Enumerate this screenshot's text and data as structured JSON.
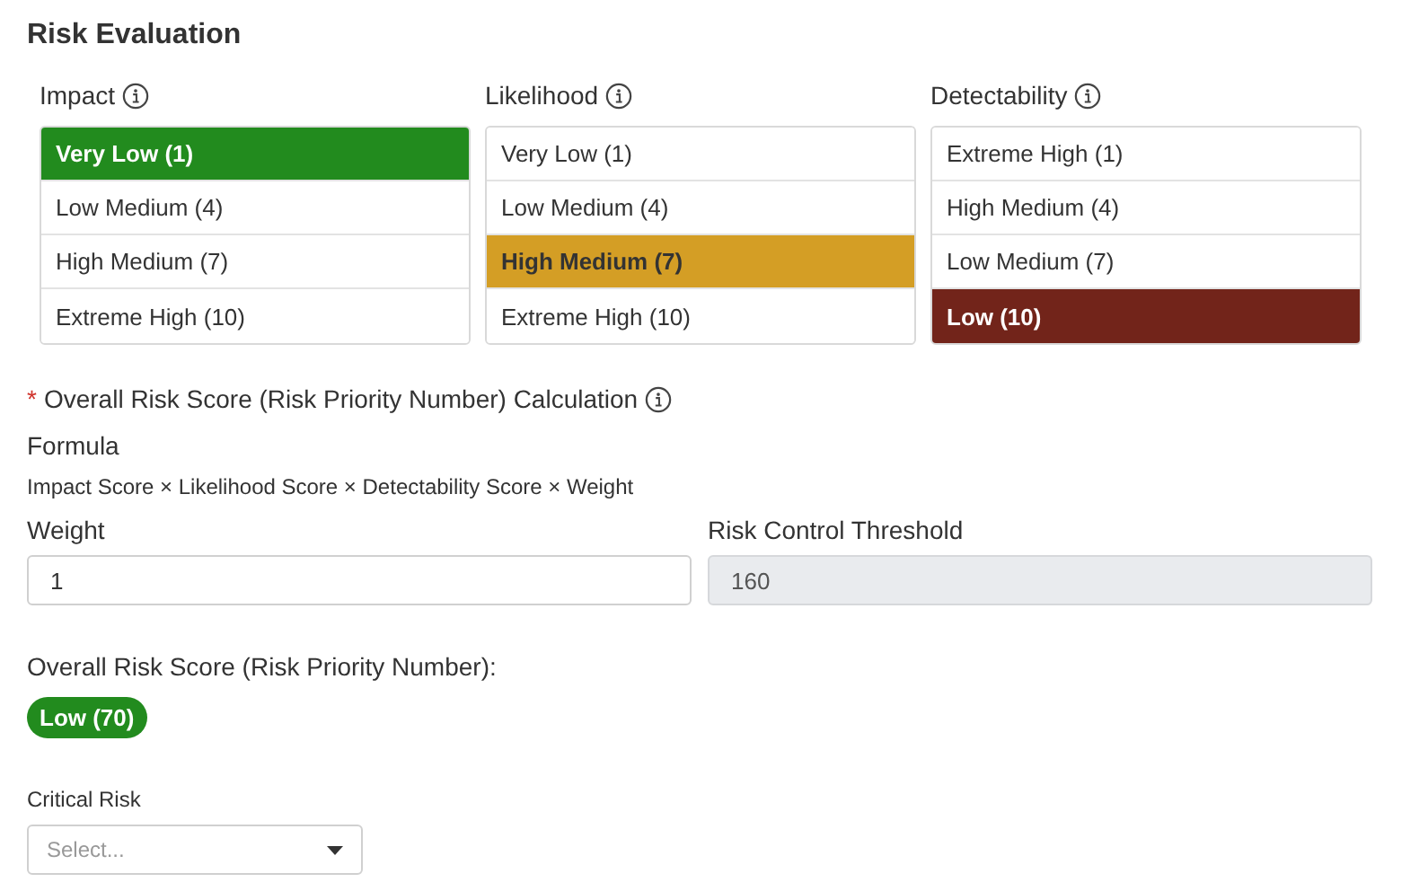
{
  "title": "Risk Evaluation",
  "groups": [
    {
      "label": "Impact",
      "color": "#228b1e",
      "options": [
        {
          "label": "Very Low (1)",
          "selected": true
        },
        {
          "label": "Low Medium (4)",
          "selected": false
        },
        {
          "label": "High Medium (7)",
          "selected": false
        },
        {
          "label": "Extreme High (10)",
          "selected": false
        }
      ]
    },
    {
      "label": "Likelihood",
      "color": "#d49e25",
      "options": [
        {
          "label": "Very Low (1)",
          "selected": false
        },
        {
          "label": "Low Medium (4)",
          "selected": false
        },
        {
          "label": "High Medium (7)",
          "selected": true
        },
        {
          "label": "Extreme High (10)",
          "selected": false
        }
      ]
    },
    {
      "label": "Detectability",
      "color": "#72241a",
      "options": [
        {
          "label": "Extreme High (1)",
          "selected": false
        },
        {
          "label": "High Medium (4)",
          "selected": false
        },
        {
          "label": "Low Medium (7)",
          "selected": false
        },
        {
          "label": "Low (10)",
          "selected": true
        }
      ]
    }
  ],
  "calculation": {
    "required_mark": "*",
    "heading": "Overall Risk Score (Risk Priority Number) Calculation",
    "formula_label": "Formula",
    "formula": "Impact Score × Likelihood Score × Detectability Score × Weight"
  },
  "weight": {
    "label": "Weight",
    "value": "1",
    "disabled": false
  },
  "threshold": {
    "label": "Risk Control Threshold",
    "value": "160",
    "disabled": true
  },
  "overall": {
    "label": "Overall Risk Score (Risk Priority Number):",
    "badge": "Low (70)",
    "color": "#228b1e"
  },
  "critical_risk": {
    "label": "Critical Risk",
    "placeholder": "Select..."
  }
}
